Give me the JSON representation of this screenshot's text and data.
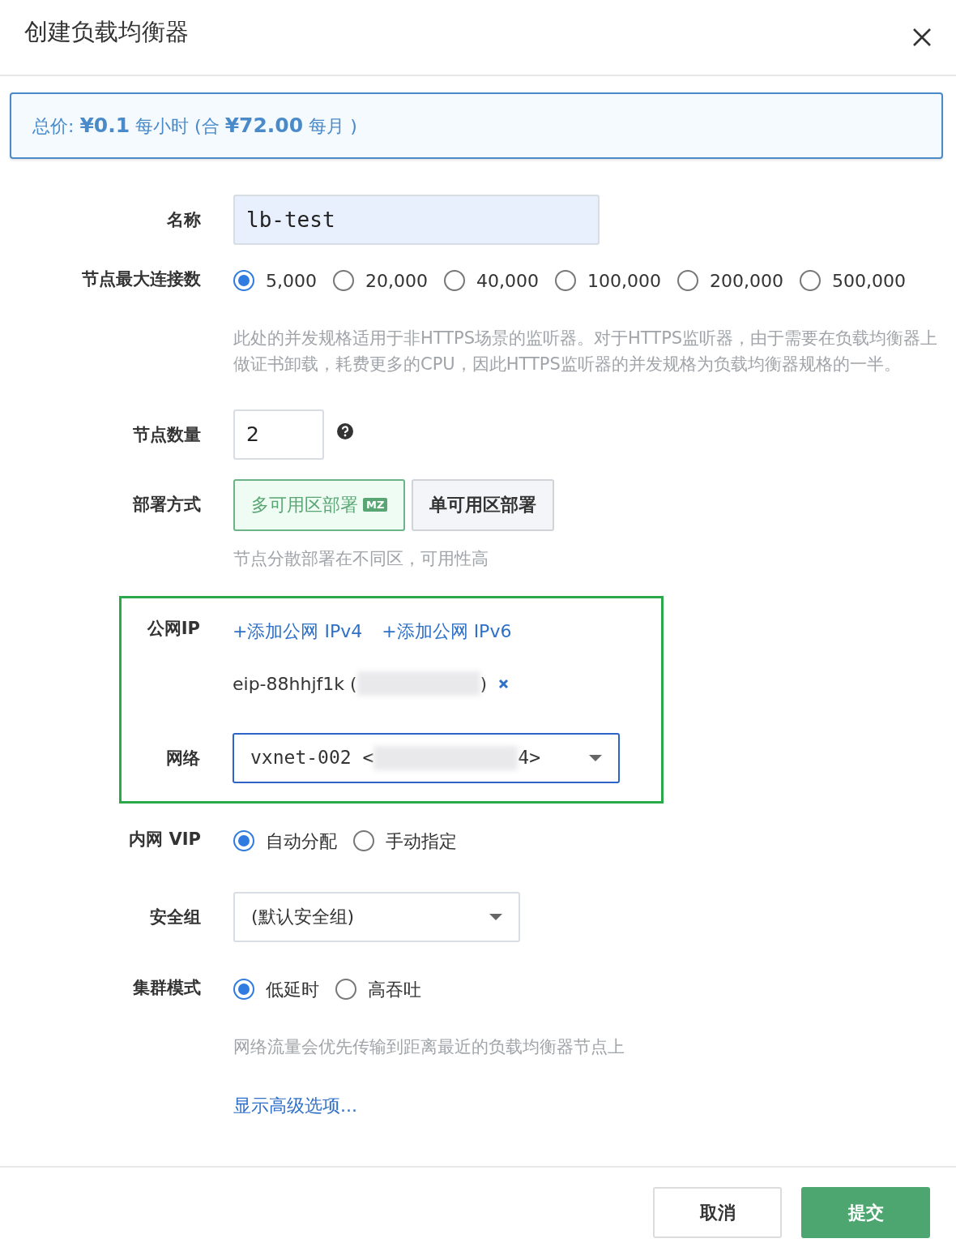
{
  "title": "创建负载均衡器",
  "price": "总价: **¥0.1** 每小时 (合  **¥72.00** 每月 )",
  "form": [
    {
      "kind": "input",
      "label": "名称",
      "value": "lb-test"
    },
    {
      "kind": "radio",
      "label": "节点最大连接数",
      "options": [
        {
          "label": "5,000",
          "selected": true
        },
        {
          "label": "20,000",
          "selected": false
        },
        {
          "label": "40,000",
          "selected": false
        },
        {
          "label": "100,000",
          "selected": false
        },
        {
          "label": "200,000",
          "selected": false
        },
        {
          "label": "500,000",
          "selected": false
        }
      ],
      "note": "此处的并发规格适用于非HTTPS场景的监听器。对于HTTPS监听器，由于需要在负载均衡器上做证书卸载，耗费更多的CPU，因此HTTPS监听器的并发规格为负载均衡器规格的一半。"
    },
    {
      "kind": "number",
      "label": "节点数量",
      "value": "2"
    },
    {
      "kind": "toggle",
      "label": "部署方式",
      "options": [
        {
          "label": "多可用区部署",
          "badge": "MZ",
          "selected": true
        },
        {
          "label": "单可用区部署",
          "selected": false
        }
      ],
      "note": "节点分散部署在不同区，可用性高"
    },
    {
      "kind": "group",
      "highlighted": true,
      "rows": [
        {
          "kind": "public_ip",
          "label": "公网IP",
          "links": [
            "+添加公网 IPv4",
            "+添加公网 IPv6"
          ],
          "eip_prefix": "eip-88hhjf1k (",
          "eip_suffix": ")"
        },
        {
          "kind": "select",
          "label": "网络",
          "value_prefix": "vxnet-002 <",
          "value_suffix": "4>",
          "focused": true
        }
      ]
    },
    {
      "kind": "radio",
      "label": "内网 VIP",
      "options": [
        {
          "label": "自动分配",
          "selected": true
        },
        {
          "label": "手动指定",
          "selected": false
        }
      ]
    },
    {
      "kind": "select",
      "label": "安全组",
      "value": "(默认安全组)",
      "focused": false
    },
    {
      "kind": "radio",
      "label": "集群模式",
      "options": [
        {
          "label": "低延时",
          "selected": true
        },
        {
          "label": "高吞吐",
          "selected": false
        }
      ],
      "note": "网络流量会优先传输到距离最近的负载均衡器节点上"
    },
    {
      "kind": "link",
      "text": "显示高级选项..."
    }
  ],
  "buttons": [
    {
      "label": "取消",
      "primary": false
    },
    {
      "label": "提交",
      "primary": true
    }
  ]
}
